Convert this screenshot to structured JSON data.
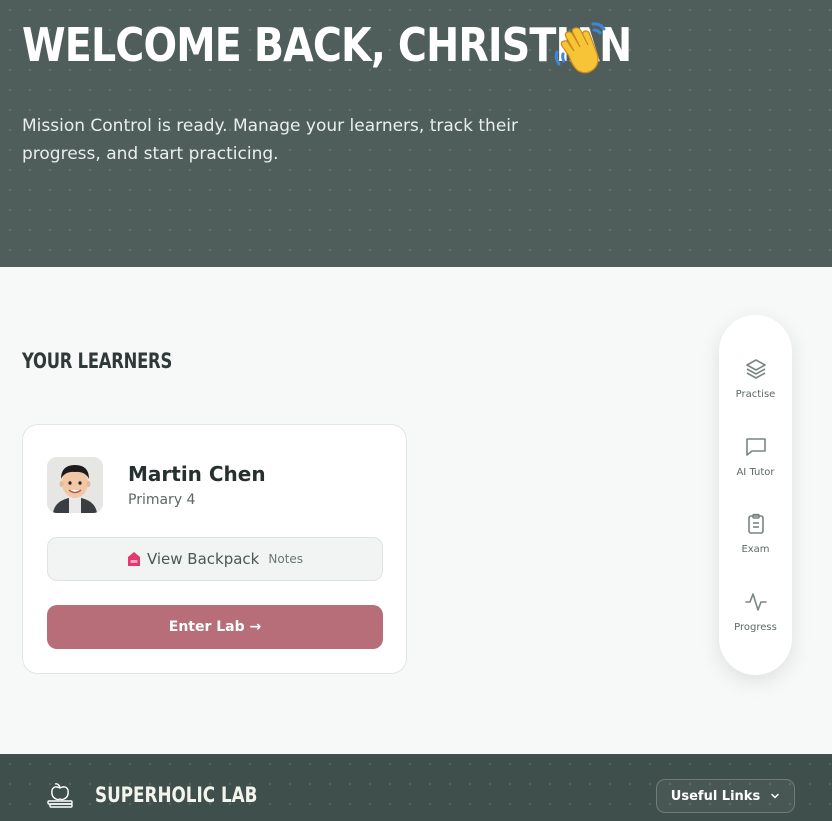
{
  "hero": {
    "title": "WELCOME BACK, CHRISTIAN",
    "emoji": "waving-hand",
    "subtitle": "Mission Control is ready. Manage your learners, track their progress, and start practicing."
  },
  "learners_section": {
    "title": "YOUR LEARNERS",
    "learners": [
      {
        "name": "Martin Chen",
        "grade": "Primary 4",
        "backpack_label": "View Backpack",
        "notes_label": "Notes",
        "enter_label": "Enter Lab →"
      }
    ]
  },
  "dock": {
    "items": [
      {
        "label": "Practise",
        "icon": "layers-icon"
      },
      {
        "label": "AI Tutor",
        "icon": "chat-icon"
      },
      {
        "label": "Exam",
        "icon": "clipboard-icon"
      },
      {
        "label": "Progress",
        "icon": "activity-icon"
      }
    ]
  },
  "footer": {
    "brand": "SUPERHOLIC LAB",
    "links_label": "Useful Links"
  },
  "colors": {
    "hero_bg": "#4f5e5b",
    "footer_bg": "#3f4f4b",
    "accent": "#b76e78"
  }
}
